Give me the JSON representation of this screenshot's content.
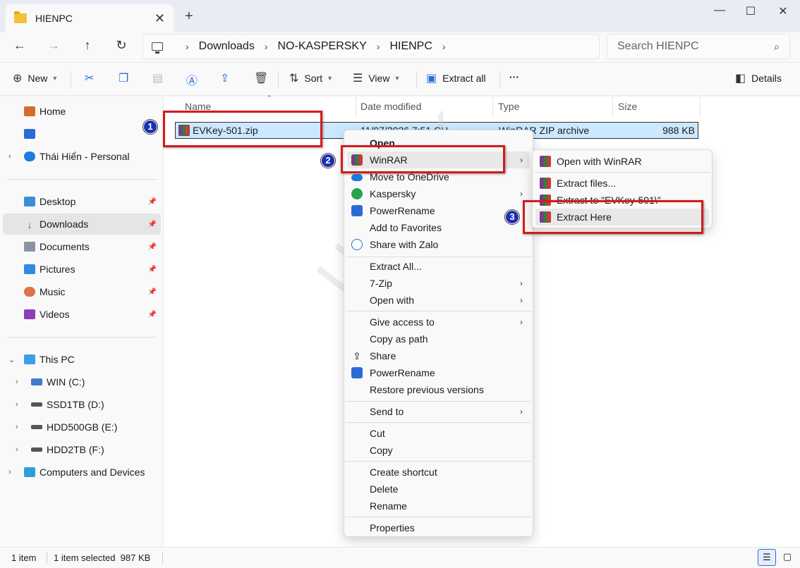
{
  "window": {
    "tab_title": "HIENPC",
    "new_tab": "+",
    "close_tab": "✕",
    "minimize": "—",
    "maximize": "☐",
    "close": "✕"
  },
  "address": {
    "crumbs": [
      "Downloads",
      "NO-KASPERSKY",
      "HIENPC"
    ],
    "search_placeholder": "Search HIENPC"
  },
  "toolbar": {
    "new_label": "New",
    "sort_label": "Sort",
    "view_label": "View",
    "extract_all_label": "Extract all",
    "more_label": "···",
    "details_label": "Details"
  },
  "sidebar": {
    "home": "Home",
    "personal": "Thái Hiển - Personal",
    "desktop": "Desktop",
    "downloads": "Downloads",
    "documents": "Documents",
    "pictures": "Pictures",
    "music": "Music",
    "videos": "Videos",
    "this_pc": "This PC",
    "drive_c": "WIN (C:)",
    "drive_d": "SSD1TB (D:)",
    "drive_e": "HDD500GB (E:)",
    "drive_f": "HDD2TB (F:)",
    "computers": "Computers and Devices"
  },
  "columns": {
    "name": "Name",
    "date": "Date modified",
    "type": "Type",
    "size": "Size"
  },
  "file": {
    "name": "EVKey-501.zip",
    "date": "11/07/2026 7:51 CH",
    "type": "WinRAR ZIP archive",
    "size": "988 KB"
  },
  "context_menu": {
    "open": "Open",
    "winrar": "WinRAR",
    "onedrive": "Move to OneDrive",
    "kaspersky": "Kaspersky",
    "powerrename1": "PowerRename",
    "favorites": "Add to Favorites",
    "zalo": "Share with Zalo",
    "extract_all": "Extract All...",
    "sevenzip": "7-Zip",
    "open_with": "Open with",
    "give_access": "Give access to",
    "copy_path": "Copy as path",
    "share": "Share",
    "powerrename2": "PowerRename",
    "restore": "Restore previous versions",
    "send_to": "Send to",
    "cut": "Cut",
    "copy": "Copy",
    "shortcut": "Create shortcut",
    "delete": "Delete",
    "rename": "Rename",
    "properties": "Properties"
  },
  "submenu": {
    "open_winrar": "Open with WinRAR",
    "extract_files": "Extract files...",
    "extract_to": "Extract to \"EVKey-501\\\"",
    "extract_here": "Extract Here"
  },
  "status": {
    "count": "1 item",
    "selected": "1 item selected  987 KB"
  },
  "annotations": {
    "step1": "1",
    "step2": "2",
    "step3": "3",
    "watermark": "UvenK"
  },
  "colors": {
    "highlight_red": "#d51a1a",
    "badge_blue": "#1c2fb3",
    "selection_blue": "#cce8ff"
  }
}
